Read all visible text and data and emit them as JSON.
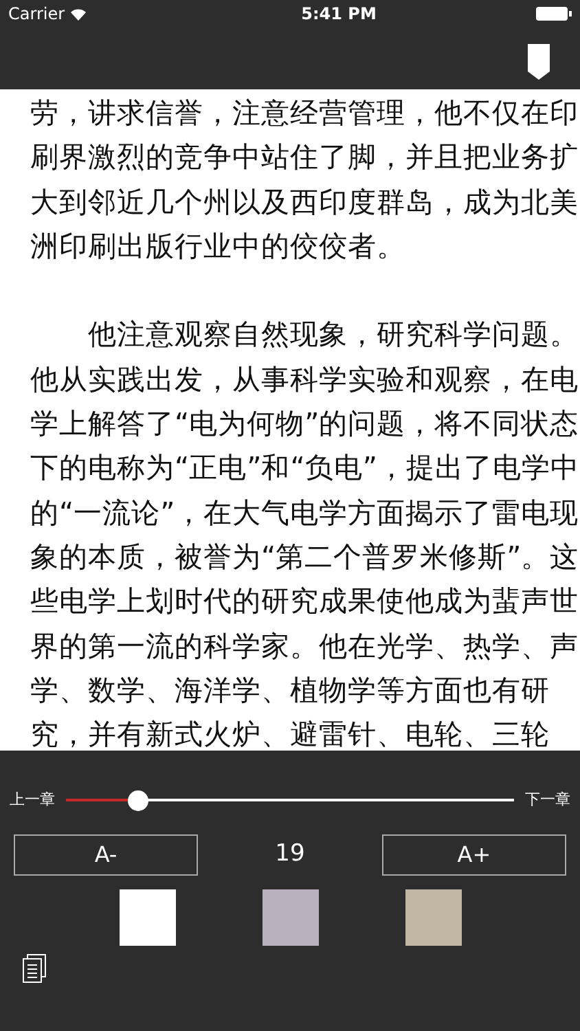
{
  "status_bar": {
    "carrier": "Carrier",
    "time": "5:41 PM"
  },
  "paragraphs": [
    [
      "劳，讲求信誉，注意经营管理，他不仅在印",
      "刷界激烈的竞争中站住了脚，并且把业务扩",
      "大到邻近几个州以及西印度群岛，成为北美",
      "洲印刷出版行业中的佼佼者。"
    ],
    [
      "　　他注意观察自然现象，研究科学问题。",
      "他从实践出发，从事科学实验和观察，在电",
      "学上解答了“电为何物”的问题，将不同状态",
      "下的电称为“正电”和“负电”，提出了电学中",
      "的“一流论”，在大气电学方面揭示了雷电现",
      "象的本质，被誉为“第二个普罗米修斯”。这",
      "些电学上划时代的研究成果使他成为蜚声世",
      "界的第一流的科学家。他在光学、热学、声",
      "学、数学、海洋学、植物学等方面也有研",
      "究，并有新式火炉、避雷针、电轮、三轮"
    ]
  ],
  "panel": {
    "prev_chapter": "上一章",
    "next_chapter": "下一章",
    "level": 0.16,
    "decrease": "A-",
    "font_size": "19",
    "increase": "A+",
    "themes": [
      {
        "color": "#ffffff"
      },
      {
        "color": "#b9b0bd"
      },
      {
        "color": "#bfb6a4"
      }
    ]
  }
}
